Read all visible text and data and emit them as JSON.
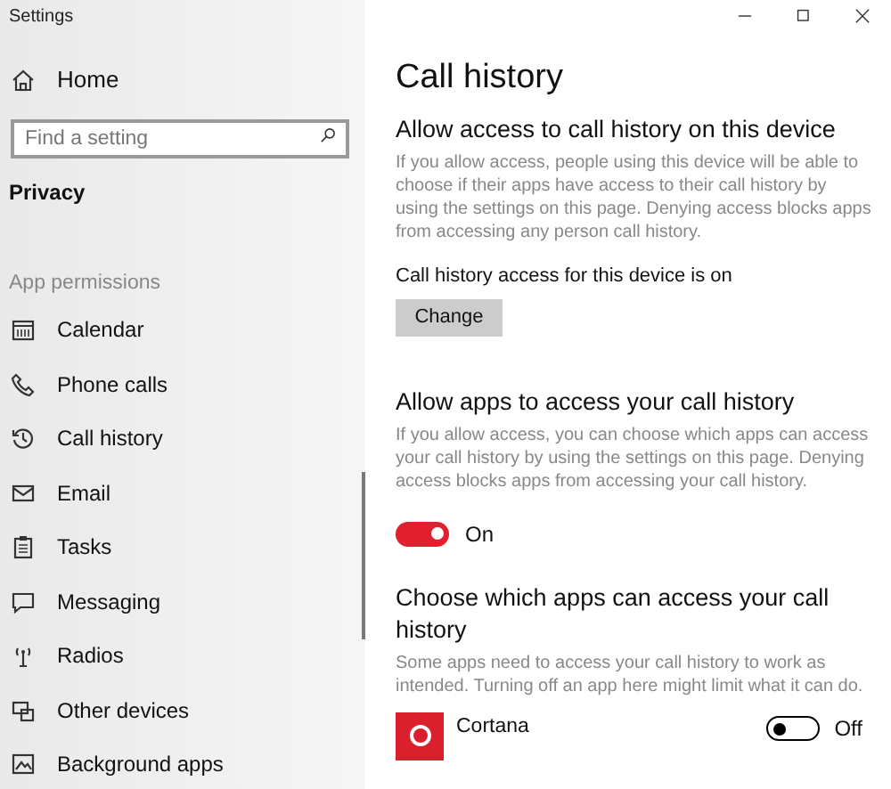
{
  "window": {
    "title": "Settings"
  },
  "sidebar": {
    "home": "Home",
    "search": {
      "placeholder": "Find a setting"
    },
    "section": "Privacy",
    "group": "App permissions",
    "items": [
      {
        "label": "Calendar"
      },
      {
        "label": "Phone calls"
      },
      {
        "label": "Call history"
      },
      {
        "label": "Email"
      },
      {
        "label": "Tasks"
      },
      {
        "label": "Messaging"
      },
      {
        "label": "Radios"
      },
      {
        "label": "Other devices"
      },
      {
        "label": "Background apps"
      }
    ]
  },
  "page": {
    "title": "Call history",
    "device_access": {
      "heading": "Allow access to call history on this device",
      "description": "If you allow access, people using this device will be able to choose if their apps have access to their call history by using the settings on this page. Denying access blocks apps from accessing any person call history.",
      "status": "Call history access for this device is on",
      "button": "Change"
    },
    "app_access": {
      "heading": "Allow apps to access your call history",
      "description": "If you allow access, you can choose which apps can access your call history by using the settings on this page. Denying access blocks apps from accessing your call history.",
      "on": true,
      "state_label": "On"
    },
    "choose": {
      "heading": "Choose which apps can access your call history",
      "description": "Some apps need to access your call history to work as intended. Turning off an app here might limit what it can do.",
      "apps": [
        {
          "name": "Cortana",
          "on": false,
          "state_label": "Off"
        }
      ]
    }
  }
}
